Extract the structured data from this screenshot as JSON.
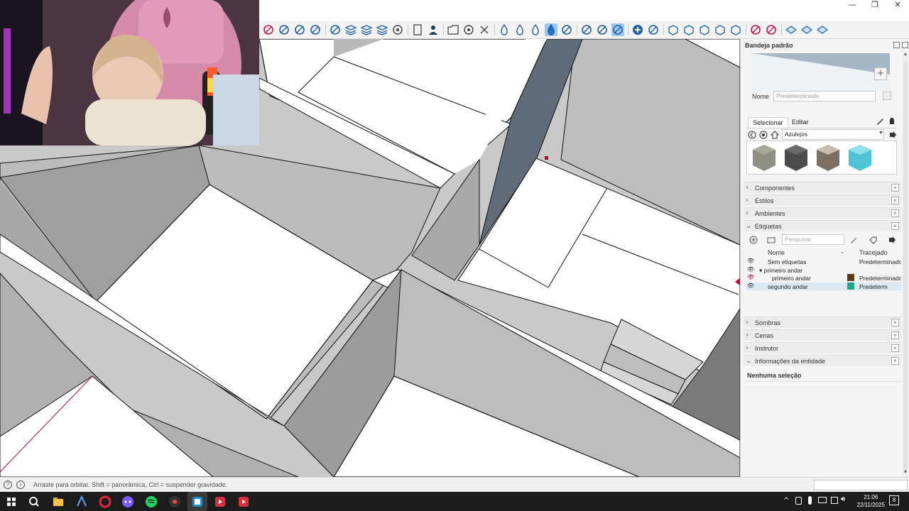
{
  "window": {
    "minimize_label": "—",
    "maximize_label": "❐",
    "close_label": "✕"
  },
  "toolbar": {
    "icons": [
      "orbit-icon",
      "pan-icon",
      "zoom-icon",
      "zoom-extents-icon",
      "section-plane-icon",
      "layer-icon",
      "layer2-icon",
      "layer3-icon",
      "target-icon",
      "page-icon",
      "user-icon",
      "rect-icon",
      "settings-icon",
      "close-x-icon",
      "drop1-icon",
      "drop2-icon",
      "drop3-icon",
      "drop4-icon",
      "diamond-icon",
      "cursor-icon",
      "magnet1-icon",
      "magnet2-icon",
      "add-circle-icon",
      "eyedrop-icon",
      "box1-icon",
      "box2-icon",
      "box3-icon",
      "box4-icon",
      "box5-icon",
      "move-icon",
      "rotate-icon",
      "flat1-icon",
      "flat2-icon",
      "flat3-icon"
    ]
  },
  "panel": {
    "title": "Bandeja padrão",
    "name_label": "Nome",
    "name_placeholder": "Predeterminado",
    "tab_select": "Selecionar",
    "tab_edit": "Editar",
    "library": "Azulejos",
    "sections_top": [
      {
        "label": "Componentes"
      },
      {
        "label": "Estilos"
      },
      {
        "label": "Ambientes"
      },
      {
        "label": "Etiquetas"
      }
    ],
    "tags": {
      "search_placeholder": "Pesquisar",
      "col_name": "Nome",
      "col_dash": "Tracejado",
      "rows": [
        {
          "name": "Sem etiquetas",
          "dash": "Predeterminado",
          "color": ""
        },
        {
          "name": "▾ primeiro andar",
          "dash": "",
          "color": ""
        },
        {
          "name": "primeiro andar",
          "dash": "Predeterminado",
          "color": "#5a3f0c"
        },
        {
          "name": "segundo andar",
          "dash": "Predeterm",
          "color": "#1aa889"
        }
      ]
    },
    "sections_bottom": [
      {
        "label": "Sombras"
      },
      {
        "label": "Cenas"
      },
      {
        "label": "Instrutor"
      },
      {
        "label": "Informações da entidade"
      }
    ],
    "entity_info": "Nenhuma seleção"
  },
  "status": {
    "text": "Arraste para orbitar. Shift = panorâmica, Ctrl = suspender gravidade."
  },
  "taskbar": {
    "time": "21:06",
    "date": "22/11/2025",
    "notif_count": "8"
  },
  "colors": {
    "accent": "#1e73be",
    "wall": "#b5b5b5",
    "wall_dark": "#8f8f8f",
    "floor": "#ffffff",
    "selected_wall": "#5f6b78"
  }
}
